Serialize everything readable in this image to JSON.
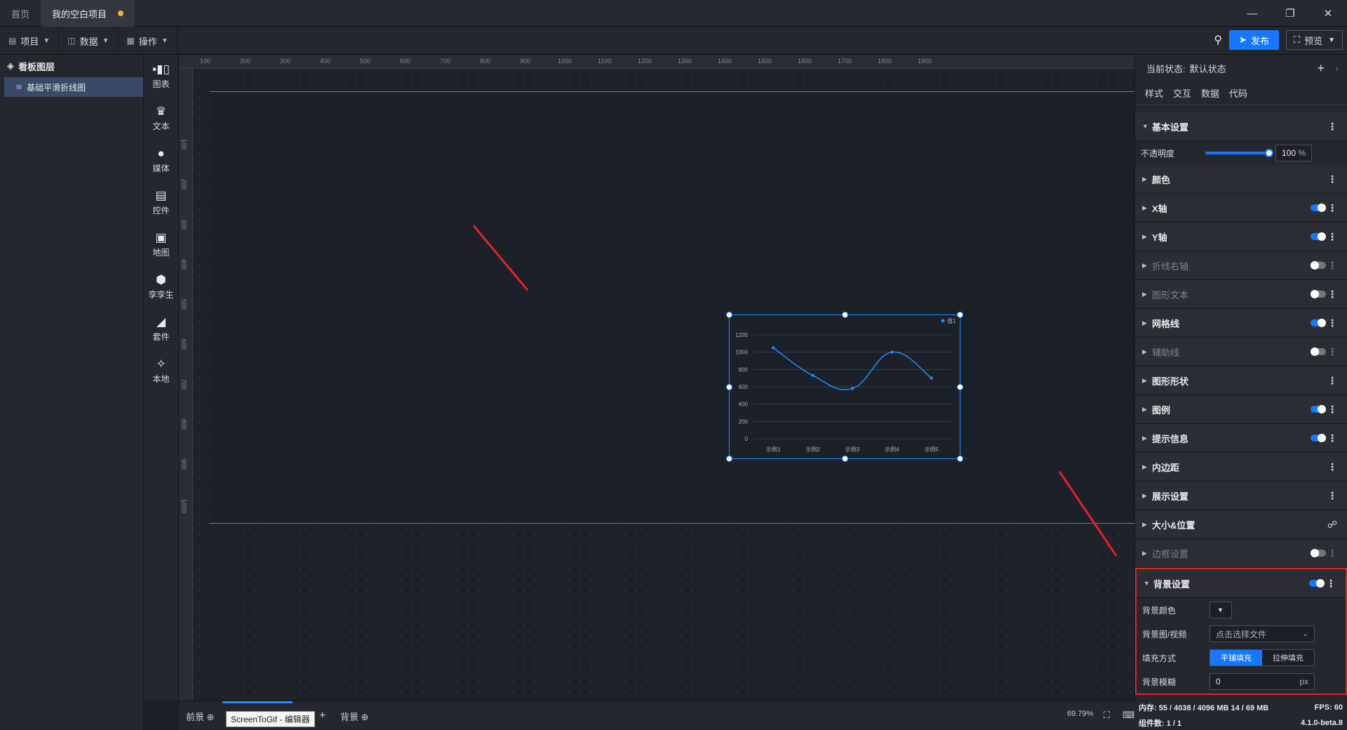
{
  "tabs": [
    {
      "label": "首页"
    },
    {
      "label": "我的空白项目"
    }
  ],
  "toolbar": {
    "menus": [
      {
        "label": "项目",
        "icon": "file-icon"
      },
      {
        "label": "数据",
        "icon": "database-icon"
      },
      {
        "label": "操作",
        "icon": "grid-icon"
      }
    ],
    "publish": "发布",
    "preview": "预览"
  },
  "layers": {
    "title": "看板图层",
    "items": [
      {
        "label": "基础平滑折线图"
      }
    ]
  },
  "components": [
    {
      "label": "图表"
    },
    {
      "label": "文本"
    },
    {
      "label": "媒体"
    },
    {
      "label": "控件"
    },
    {
      "label": "地图"
    },
    {
      "label": "孪孪生"
    },
    {
      "label": "套件"
    },
    {
      "label": "本地"
    }
  ],
  "ruler": {
    "top": [
      "100",
      "200",
      "300",
      "400",
      "500",
      "600",
      "700",
      "800",
      "900",
      "1000",
      "1100",
      "1200",
      "1300",
      "1400",
      "1500",
      "1600",
      "1700",
      "1800",
      "1900"
    ],
    "left": [
      "100",
      "200",
      "300",
      "400",
      "500",
      "600",
      "700",
      "800",
      "900",
      "1000"
    ]
  },
  "chart_data": {
    "type": "line",
    "categories": [
      "示例1",
      "示例2",
      "示例3",
      "示例4",
      "示例5"
    ],
    "series": [
      {
        "name": "值1",
        "values": [
          1050,
          730,
          580,
          1000,
          700
        ]
      }
    ],
    "ylim": [
      0,
      1200
    ],
    "yticks": [
      "0",
      "200",
      "400",
      "600",
      "800",
      "1000",
      "1200"
    ],
    "smooth": true,
    "legend": "top-right",
    "grid": true,
    "color": "#1f8bff"
  },
  "bottom": {
    "front": "前景",
    "back": "背景",
    "tooltip": "ScreenToGif - 编辑器",
    "zoom": "69.79%"
  },
  "props": {
    "state_label": "当前状态:",
    "state_value": "默认状态",
    "tabs": [
      "样式",
      "交互",
      "数据",
      "代码"
    ],
    "sections": {
      "basic": "基本设置",
      "opacity_label": "不透明度",
      "opacity_value": "100",
      "opacity_unit": "%",
      "color": "颜色",
      "xaxis": "X轴",
      "yaxis": "Y轴",
      "right_axis": "折线右轴",
      "shape_text": "图形文本",
      "grid": "网格线",
      "guide": "辅助线",
      "shape": "图形形状",
      "legend": "图例",
      "tip": "提示信息",
      "padding": "内边距",
      "display": "展示设置",
      "size_pos": "大小&位置",
      "border": "边框设置",
      "bg": "背景设置"
    },
    "bg": {
      "color_label": "背景颜色",
      "image_label": "背景图/视频",
      "image_placeholder": "点击选择文件",
      "fill_label": "填充方式",
      "fill_tile": "平铺填充",
      "fill_stretch": "拉伸填充",
      "blur_label": "背景模糊",
      "blur_value": "0",
      "blur_unit": "px"
    }
  },
  "status": {
    "memory": "内存: 55 / 4038 / 4096 MB 14 / 69 MB",
    "fps": "FPS: 60",
    "count": "组件数: 1 / 1",
    "version": "4.1.0-beta.8"
  }
}
